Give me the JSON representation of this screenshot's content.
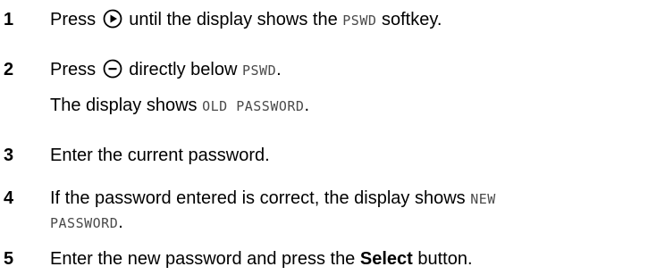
{
  "steps": [
    {
      "number": "1",
      "parts": {
        "t1": "Press",
        "icon": "play-right-icon",
        "t2": "until the display shows the",
        "lcd": "PSWD",
        "t3": "softkey."
      }
    },
    {
      "number": "2",
      "parts": {
        "t1": "Press",
        "icon": "minus-softkey-icon",
        "t2": "directly below",
        "lcd": "PSWD",
        "t3": "."
      },
      "note": {
        "t1": "The display shows",
        "lcd": "OLD PASSWORD",
        "t2": "."
      }
    },
    {
      "number": "3",
      "parts": {
        "t1": "Enter the current password."
      }
    },
    {
      "number": "4",
      "parts": {
        "t1": "If the password entered is correct, the display shows",
        "lcd1": "NEW",
        "lcd2": "PASSWORD",
        "t2": "."
      }
    },
    {
      "number": "5",
      "parts": {
        "t1": "Enter the new password and press the",
        "bold": "Select",
        "t2": "button."
      }
    }
  ],
  "colors": {
    "text": "#000000",
    "lcd_text": "#4a4a4a"
  }
}
